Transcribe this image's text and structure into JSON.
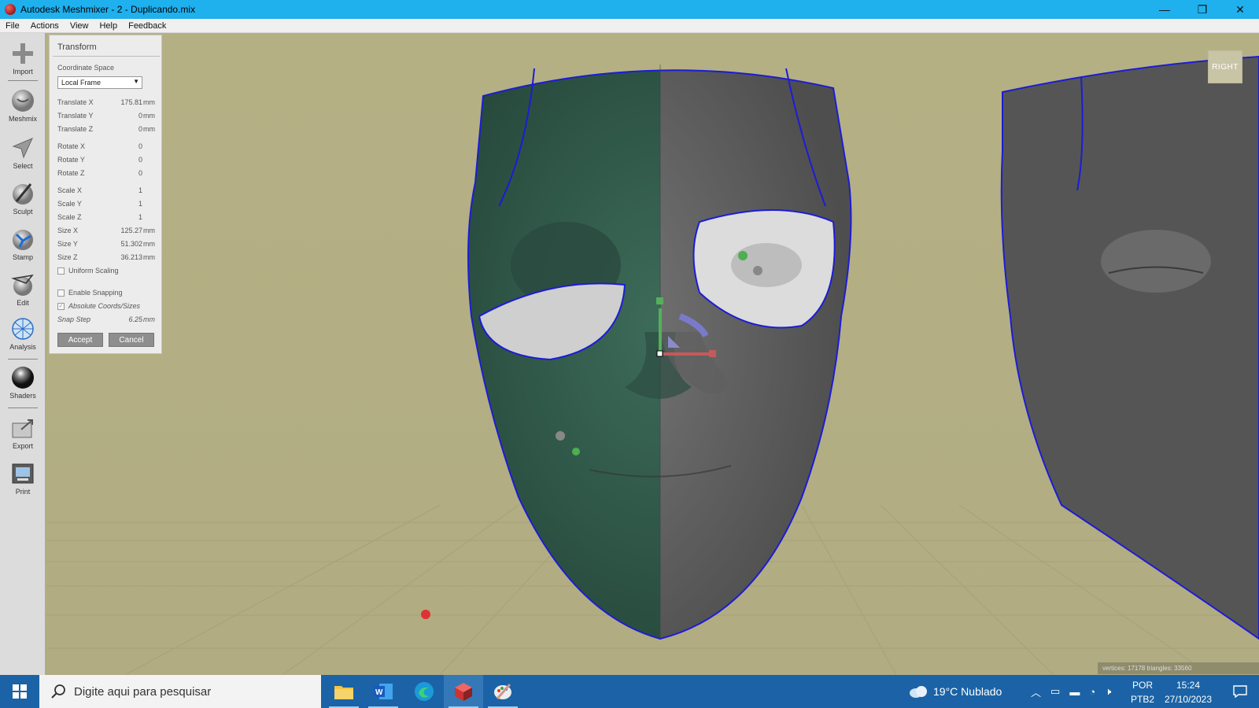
{
  "window": {
    "title": "Autodesk Meshmixer - 2 - Duplicando.mix",
    "minimize": "—",
    "maximize": "❐",
    "close": "✕"
  },
  "menu": [
    "File",
    "Actions",
    "View",
    "Help",
    "Feedback"
  ],
  "toolbar": [
    {
      "label": "Import",
      "icon": "import-icon"
    },
    {
      "label": "Meshmix",
      "icon": "meshmix-icon"
    },
    {
      "label": "Select",
      "icon": "select-icon"
    },
    {
      "label": "Sculpt",
      "icon": "sculpt-icon"
    },
    {
      "label": "Stamp",
      "icon": "stamp-icon"
    },
    {
      "label": "Edit",
      "icon": "edit-icon"
    },
    {
      "label": "Analysis",
      "icon": "analysis-icon"
    },
    {
      "label": "Shaders",
      "icon": "shaders-icon"
    },
    {
      "label": "Export",
      "icon": "export-icon"
    },
    {
      "label": "Print",
      "icon": "print-icon"
    }
  ],
  "transform": {
    "title": "Transform",
    "coordinate_space_label": "Coordinate Space",
    "coordinate_space_value": "Local Frame",
    "rows": [
      {
        "label": "Translate X",
        "value": "175.81",
        "unit": "mm"
      },
      {
        "label": "Translate Y",
        "value": "0",
        "unit": "mm"
      },
      {
        "label": "Translate Z",
        "value": "0",
        "unit": "mm"
      },
      {
        "label": "Rotate X",
        "value": "0",
        "unit": ""
      },
      {
        "label": "Rotate Y",
        "value": "0",
        "unit": ""
      },
      {
        "label": "Rotate Z",
        "value": "0",
        "unit": ""
      },
      {
        "label": "Scale X",
        "value": "1",
        "unit": ""
      },
      {
        "label": "Scale Y",
        "value": "1",
        "unit": ""
      },
      {
        "label": "Scale Z",
        "value": "1",
        "unit": ""
      },
      {
        "label": "Size X",
        "value": "125.27",
        "unit": "mm"
      },
      {
        "label": "Size Y",
        "value": "51.302",
        "unit": "mm"
      },
      {
        "label": "Size Z",
        "value": "36.213",
        "unit": "mm"
      }
    ],
    "uniform_scaling": "Uniform Scaling",
    "enable_snapping": "Enable Snapping",
    "absolute_coords": "Absolute Coords/Sizes",
    "snap_step_label": "Snap Step",
    "snap_step_value": "6.25",
    "snap_step_unit": "mm",
    "accept": "Accept",
    "cancel": "Cancel"
  },
  "viewport": {
    "viewcube_label": "RIGHT",
    "stats": "vertices: 17178 triangles: 33560"
  },
  "taskbar": {
    "search_placeholder": "Digite aqui para pesquisar",
    "weather": "19°C  Nublado",
    "lang_top": "POR",
    "lang_bottom": "PTB2",
    "time": "15:24",
    "date": "27/10/2023"
  }
}
